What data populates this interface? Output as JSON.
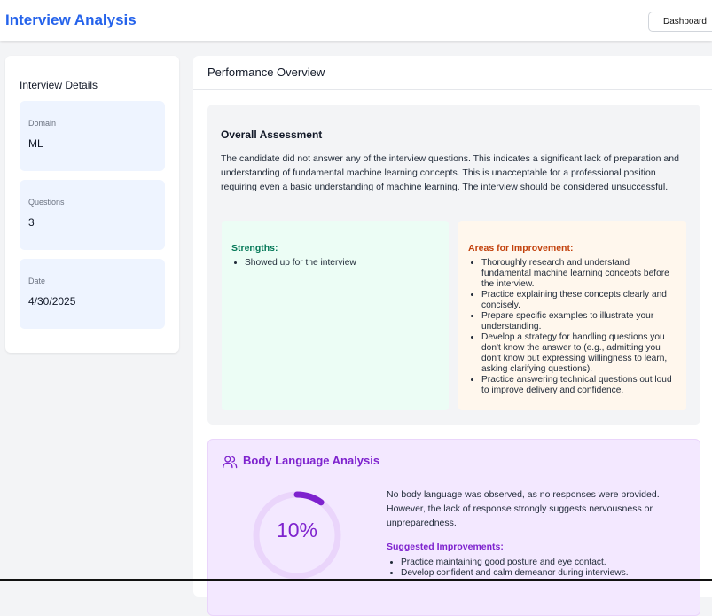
{
  "header": {
    "title": "Interview Analysis",
    "dashboard_label": "Dashboard"
  },
  "details": {
    "title": "Interview Details",
    "items": [
      {
        "label": "Domain",
        "value": "ML"
      },
      {
        "label": "Questions",
        "value": "3"
      },
      {
        "label": "Date",
        "value": "4/30/2025"
      }
    ]
  },
  "overview": {
    "title": "Performance Overview",
    "assessment_title": "Overall Assessment",
    "assessment_text": "The candidate did not answer any of the interview questions. This indicates a significant lack of preparation and understanding of fundamental machine learning concepts. This is unacceptable for a professional position requiring even a basic understanding of machine learning. The interview should be considered unsuccessful.",
    "strengths_title": "Strengths:",
    "strengths": [
      "Showed up for the interview"
    ],
    "improvements_title": "Areas for Improvement:",
    "improvements": [
      "Thoroughly research and understand fundamental machine learning concepts before the interview.",
      "Practice explaining these concepts clearly and concisely.",
      "Prepare specific examples to illustrate your understanding.",
      "Develop a strategy for handling questions you don't know the answer to (e.g., admitting you don't know but expressing willingness to learn, asking clarifying questions).",
      "Practice answering technical questions out loud to improve delivery and confidence."
    ]
  },
  "body_language": {
    "title": "Body Language Analysis",
    "icon": "users-icon",
    "score": 0.1,
    "score_label": "10%",
    "text": "No body language was observed, as no responses were provided. However, the lack of response strongly suggests nervousness or unpreparedness.",
    "suggested_title": "Suggested Improvements:",
    "suggested": [
      "Practice maintaining good posture and eye contact.",
      "Develop confident and calm demeanor during interviews."
    ]
  },
  "colors": {
    "brand": "#2563eb",
    "purple": "#7e22ce",
    "green": "#047857",
    "orange": "#c2410c"
  }
}
